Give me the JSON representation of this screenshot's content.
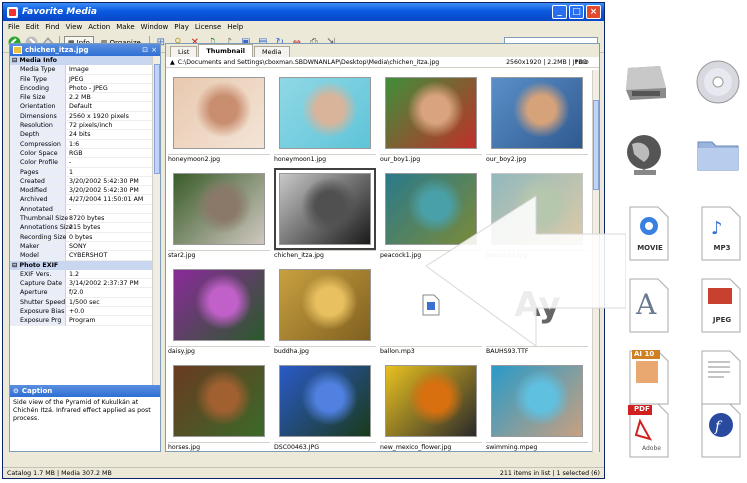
{
  "window": {
    "title": "Favorite Media",
    "controls": [
      "_",
      "□",
      "×"
    ]
  },
  "menu": [
    "File",
    "Edit",
    "Find",
    "View",
    "Action",
    "Make",
    "Window",
    "Play",
    "License",
    "Help"
  ],
  "toolbar": {
    "info_label": "Info",
    "organize_label": "Organize"
  },
  "info_panel": {
    "title": "chichen_itza.jpg",
    "sections": [
      {
        "name": "Media Info",
        "rows": [
          [
            "Media Type",
            "Image"
          ],
          [
            "File Type",
            "JPEG"
          ],
          [
            "Encoding",
            "Photo - JPEG"
          ],
          [
            "File Size",
            "2.2 MB"
          ],
          [
            "Orientation",
            "Default"
          ],
          [
            "Dimensions",
            "2560 x 1920 pixels"
          ],
          [
            "Resolution",
            "72 pixels/inch"
          ],
          [
            "Depth",
            "24 bits"
          ],
          [
            "Compression",
            "1:6"
          ],
          [
            "Color Space",
            "RGB"
          ],
          [
            "Color Profile",
            "-"
          ],
          [
            "Pages",
            "1"
          ],
          [
            "Created",
            "3/20/2002 5:42:30 PM"
          ],
          [
            "Modified",
            "3/20/2002 5:42:30 PM"
          ],
          [
            "Archived",
            "4/27/2004 11:50:01 AM"
          ],
          [
            "Annotated",
            "-"
          ],
          [
            "Thumbnail Size",
            "8720 bytes"
          ],
          [
            "Annotations Size",
            "215 bytes"
          ],
          [
            "Recording Size",
            "0 bytes"
          ],
          [
            "Maker",
            "SONY"
          ],
          [
            "Model",
            "CYBERSHOT"
          ]
        ]
      },
      {
        "name": "Photo EXIF",
        "rows": [
          [
            "EXIF Vers.",
            "1.2"
          ],
          [
            "Capture Date",
            "3/14/2002 2:37:37 PM"
          ],
          [
            "Aperture",
            "f/2.0"
          ],
          [
            "Shutter Speed",
            "1/500 sec"
          ],
          [
            "Exposure Bias",
            "+0.0"
          ],
          [
            "Exposure Prg",
            "Program"
          ]
        ]
      }
    ],
    "caption_title": "Caption",
    "caption_text": "Side view of the Pyramid of Kukulkán at Chichén Itzá. Infrared effect applied as post process."
  },
  "tabs": [
    "List",
    "Thumbnail",
    "Media"
  ],
  "active_tab": "Thumbnail",
  "path": "C:\\Documents and Settings\\cboxman.SBDWNANLAP\\Desktop\\Media\\chichen_itza.jpg",
  "path_info": "2560x1920 | 2.2MB | JPEG",
  "thumbnails": [
    {
      "label": "honeymoon2.jpg",
      "kind": "photo",
      "colors": [
        "#e8c9b0",
        "#c98e70",
        "#f4e4d6"
      ]
    },
    {
      "label": "honeymoon1.jpg",
      "kind": "photo",
      "colors": [
        "#8fd8e6",
        "#d9b49a",
        "#5fc4d8"
      ]
    },
    {
      "label": "our_boy1.jpg",
      "kind": "photo",
      "colors": [
        "#3f8f3a",
        "#d8a37e",
        "#c0302a"
      ]
    },
    {
      "label": "our_boy2.jpg",
      "kind": "photo",
      "colors": [
        "#5a8fc8",
        "#d6a27a",
        "#2f5a90"
      ]
    },
    {
      "label": "star2.jpg",
      "kind": "photo",
      "colors": [
        "#3a5c2a",
        "#8a7868",
        "#d0c8c0"
      ]
    },
    {
      "label": "chichen_itza.jpg",
      "kind": "photo",
      "colors": [
        "#c8c8c8",
        "#505050",
        "#1a1a1a"
      ],
      "selected": true
    },
    {
      "label": "peacock1.jpg",
      "kind": "photo",
      "colors": [
        "#2a7a8a",
        "#4aa0a8",
        "#7a8a3a"
      ]
    },
    {
      "label": "peacock2.jpg",
      "kind": "photo",
      "colors": [
        "#3a8088",
        "#7a9a6a",
        "#c0a060"
      ],
      "dim": true
    },
    {
      "label": "daisy.jpg",
      "kind": "photo",
      "colors": [
        "#8a2a9a",
        "#c060c8",
        "#2a5a2a"
      ]
    },
    {
      "label": "buddha.jpg",
      "kind": "photo",
      "colors": [
        "#c8a040",
        "#e8c060",
        "#806020"
      ]
    },
    {
      "label": "ballon.mp3",
      "kind": "file"
    },
    {
      "label": "BAUHS93.TTF",
      "kind": "font"
    },
    {
      "label": "horses.jpg",
      "kind": "photo",
      "colors": [
        "#6a3a20",
        "#a06030",
        "#3a6a2a"
      ]
    },
    {
      "label": "DSC00463.JPG",
      "kind": "photo",
      "colors": [
        "#2a5ac8",
        "#5080e0",
        "#1a3a1a"
      ]
    },
    {
      "label": "new_mexico_flower.jpg",
      "kind": "photo",
      "colors": [
        "#e8c020",
        "#d87010",
        "#2a2a2a"
      ]
    },
    {
      "label": "swimming.mpeg",
      "kind": "photo",
      "colors": [
        "#2a9ac8",
        "#60c0e0",
        "#c8a080"
      ]
    }
  ],
  "font_sample": "Ay",
  "status": {
    "left": "Catalog  1.7 MB  |  Media 307.2 MB",
    "right": "211 items in list  |  1 selected (6)"
  },
  "file_icons": [
    {
      "name": "hard-disk-icon"
    },
    {
      "name": "cd-icon"
    },
    {
      "name": "globe-icon"
    },
    {
      "name": "folder-icon"
    },
    {
      "name": "movie-file-icon",
      "label": "MOVIE"
    },
    {
      "name": "mp3-file-icon",
      "label": "MP3"
    },
    {
      "name": "font-file-icon"
    },
    {
      "name": "jpeg-file-icon",
      "label": "JPEG"
    },
    {
      "name": "ai-file-icon",
      "label": "AI 10"
    },
    {
      "name": "text-file-icon"
    },
    {
      "name": "pdf-file-icon",
      "label": "PDF",
      "sublabel": "Adobe"
    },
    {
      "name": "flash-file-icon"
    }
  ],
  "colors": {
    "titlebar": "#0a5ae0",
    "panel_header": "#2f6fd4",
    "window_bg": "#ece9d8"
  }
}
